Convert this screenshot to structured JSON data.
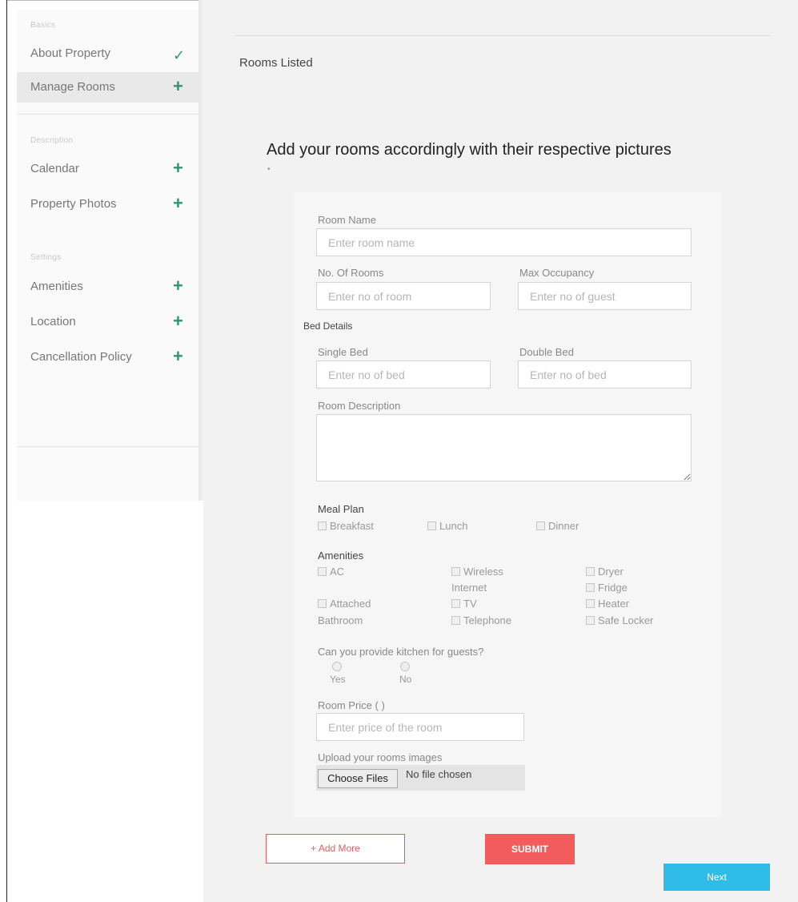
{
  "sidebar": {
    "sections": [
      {
        "heading": "Basics"
      },
      {
        "heading": "Description"
      },
      {
        "heading": "Settings"
      }
    ],
    "items": [
      {
        "label": "About Property",
        "icon": "check-icon"
      },
      {
        "label": "Manage Rooms",
        "icon": "plus-icon"
      },
      {
        "label": "Calendar",
        "icon": "plus-icon"
      },
      {
        "label": "Property Photos",
        "icon": "plus-icon"
      },
      {
        "label": "Amenities",
        "icon": "plus-icon"
      },
      {
        "label": "Location",
        "icon": "plus-icon"
      },
      {
        "label": "Cancellation Policy",
        "icon": "plus-icon"
      }
    ],
    "check_glyph": "✓",
    "plus_glyph": "+"
  },
  "main": {
    "rooms_listed": "Rooms Listed",
    "headline": "Add your rooms accordingly with their respective pictures",
    "headline_dot": "•"
  },
  "form": {
    "room_name_label": "Room Name",
    "room_name_placeholder": "Enter room name",
    "no_rooms_label": "No. Of Rooms",
    "no_rooms_placeholder": "Enter no of room",
    "max_occupancy_label": "Max Occupancy",
    "max_occupancy_placeholder": "Enter no of guest",
    "bed_details_label": "Bed Details",
    "single_bed_label": "Single Bed",
    "single_bed_placeholder": "Enter no of bed",
    "double_bed_label": "Double Bed",
    "double_bed_placeholder": "Enter no of bed",
    "room_description_label": "Room Description",
    "meal_plan_label": "Meal Plan",
    "meal_plan_options": [
      "Breakfast",
      "Lunch",
      "Dinner"
    ],
    "amenities_label": "Amenities",
    "amenities": {
      "ac": "AC",
      "attached_1": "Attached",
      "attached_2": "Bathroom",
      "wireless_1": "Wireless",
      "wireless_2": "Internet",
      "tv": "TV",
      "telephone": "Telephone",
      "dryer": "Dryer",
      "fridge": "Fridge",
      "heater": "Heater",
      "safe_locker": "Safe Locker"
    },
    "kitchen_question": "Can you provide kitchen for guests?",
    "kitchen_options": [
      "Yes",
      "No"
    ],
    "room_price_label": "Room Price (  )",
    "room_price_placeholder": "Enter price of the room",
    "upload_label": "Upload your rooms images",
    "choose_files": "Choose Files",
    "no_file": "No file chosen"
  },
  "actions": {
    "add_more": "+ Add More",
    "submit": "SUBMIT",
    "next": "Next"
  },
  "colors": {
    "accent_green": "#2a9a6a",
    "submit_red": "#f25c5c",
    "next_blue": "#2fbde8"
  }
}
